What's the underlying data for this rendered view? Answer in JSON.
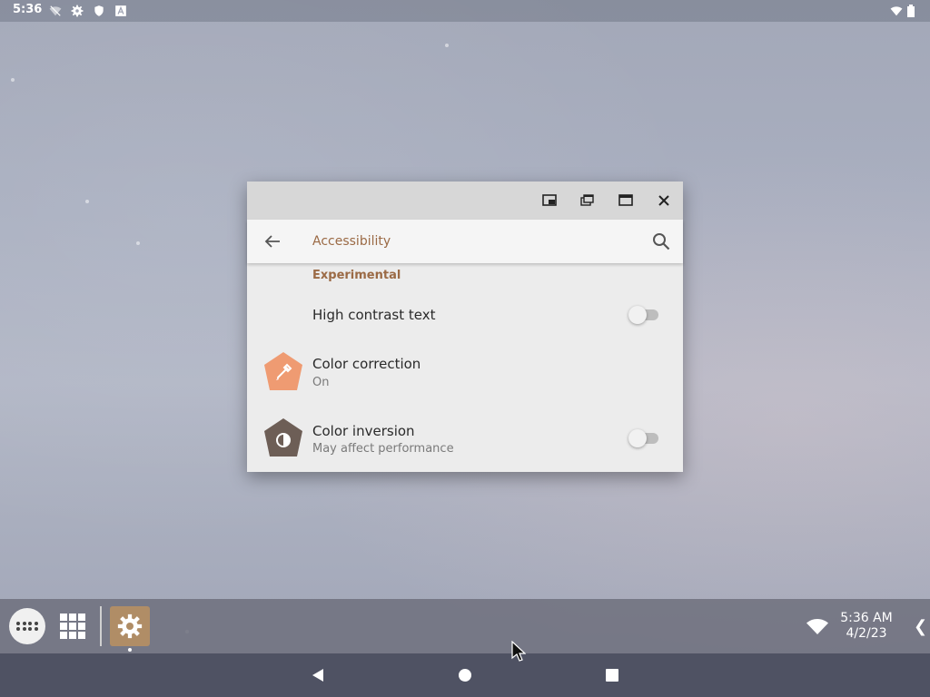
{
  "statusbar": {
    "time": "5:36",
    "icons": [
      "wifi-off-icon",
      "gear-icon",
      "shield-icon",
      "text-a-icon",
      "wifi-icon",
      "battery-icon"
    ]
  },
  "window": {
    "controls": [
      "pip-icon",
      "restore-icon",
      "maximize-icon",
      "close-icon"
    ],
    "appbar": {
      "title": "Accessibility",
      "back_icon": "arrow-back-icon",
      "search_icon": "search-icon"
    },
    "section_header": "Experimental",
    "rows": [
      {
        "title": "High contrast text",
        "toggle": "off"
      },
      {
        "title": "Color correction",
        "subtitle": "On",
        "icon": "eyedropper-icon",
        "icon_color": "#ef9b72"
      },
      {
        "title": "Color inversion",
        "subtitle": "May affect performance",
        "icon": "invert-colors-icon",
        "icon_color": "#6d5e56",
        "toggle": "off"
      }
    ]
  },
  "taskbar": {
    "time": "5:36 AM",
    "date": "4/2/23",
    "chevron": "❮",
    "app_accent": "#b08d66"
  },
  "navbar": {
    "buttons": [
      "back-triangle-icon",
      "home-circle-icon",
      "recents-square-icon"
    ]
  },
  "colors": {
    "accent": "#9b6a45",
    "window_bg": "#ececec",
    "titlebar_bg": "#d7d7d7"
  }
}
